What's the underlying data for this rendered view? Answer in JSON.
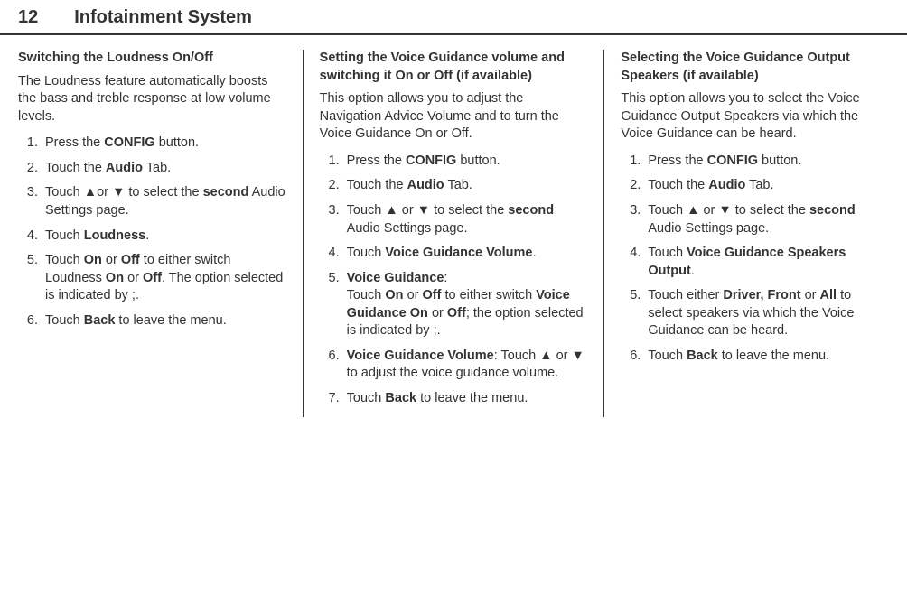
{
  "header": {
    "page_number": "12",
    "title": "Infotainment System"
  },
  "col1": {
    "heading": "Switching the Loudness On/Off",
    "intro": "The Loudness feature automatically boosts the bass and treble response at low volume levels.",
    "s1a": "Press the ",
    "s1b": "CONFIG",
    "s1c": " button.",
    "s2a": "Touch the ",
    "s2b": "Audio",
    "s2c": " Tab.",
    "s3a": "Touch ▲or ▼ to select the ",
    "s3b": "second",
    "s3c": " Audio Settings page.",
    "s4a": "Touch ",
    "s4b": "Loudness",
    "s4c": ".",
    "s5a": "Touch ",
    "s5b": "On",
    "s5c": " or ",
    "s5d": "Off",
    "s5e": " to either switch Loudness ",
    "s5f": "On",
    "s5g": " or ",
    "s5h": "Off",
    "s5i": ". The option selected is indicated by ",
    "s5j": ";",
    "s5k": ".",
    "s6a": "Touch ",
    "s6b": "Back",
    "s6c": " to leave the menu."
  },
  "col2": {
    "heading": "Setting the Voice Guidance volume and switching it On or Off (if available)",
    "intro": "This option allows you to adjust the Navigation Advice Volume and to turn the Voice Guidance On or Off.",
    "s1a": "Press the ",
    "s1b": "CONFIG",
    "s1c": " button.",
    "s2a": "Touch the ",
    "s2b": "Audio",
    "s2c": " Tab.",
    "s3a": "Touch ▲ or ▼ to select the ",
    "s3b": "second",
    "s3c": " Audio Settings page.",
    "s4a": "Touch ",
    "s4b": "Voice Guidance Volume",
    "s4c": ".",
    "s5a": "Voice Guidance",
    "s5b": ":",
    "s5c": "Touch ",
    "s5d": "On",
    "s5e": " or ",
    "s5f": "Off",
    "s5g": " to either switch ",
    "s5h": "Voice Guidance On",
    "s5i": " or ",
    "s5j": "Off",
    "s5k": "; the option selected is indicated by ",
    "s5l": ";",
    "s5m": ".",
    "s6a": "Voice Guidance Volume",
    "s6b": ": Touch ▲ or ▼ to adjust the voice guidance volume.",
    "s7a": "Touch ",
    "s7b": "Back",
    "s7c": " to leave the menu."
  },
  "col3": {
    "heading": "Selecting the Voice Guidance Output Speakers (if available)",
    "intro": "This option allows you to select the Voice Guidance Output Speakers via which the Voice Guidance can be heard.",
    "s1a": "Press the ",
    "s1b": "CONFIG",
    "s1c": " button.",
    "s2a": "Touch the ",
    "s2b": "Audio",
    "s2c": " Tab.",
    "s3a": "Touch ▲ or ▼ to select the ",
    "s3b": "second",
    "s3c": " Audio Settings page.",
    "s4a": "Touch ",
    "s4b": "Voice Guidance Speakers Output",
    "s4c": ".",
    "s5a": "Touch either ",
    "s5b": "Driver, Front",
    "s5c": " or ",
    "s5d": "All",
    "s5e": " to select speakers via which the Voice Guidance can be heard.",
    "s6a": "Touch ",
    "s6b": "Back",
    "s6c": " to leave the menu."
  }
}
